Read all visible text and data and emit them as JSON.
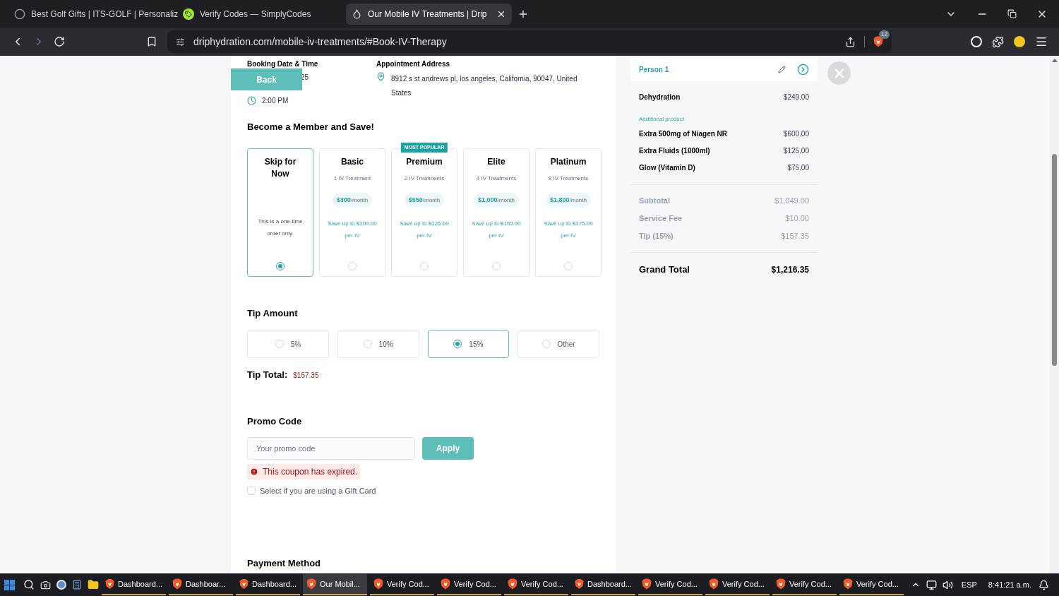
{
  "browser": {
    "tabs": [
      {
        "title": "Best Golf Gifts | ITS-GOLF | Personaliz",
        "selected": false
      },
      {
        "title": "Verify Codes — SimplyCodes",
        "selected": false
      },
      {
        "title": "Our Mobile IV Treatments | Drip",
        "selected": true
      }
    ],
    "url": "driphydration.com/mobile-iv-treatments/#Book-IV-Therapy",
    "shield_count": "12"
  },
  "booking": {
    "date_label": "Booking Date & Time",
    "date": "25",
    "time": "2:00 PM",
    "address_label": "Appointment Address",
    "address": "8912 s st andrews pl, los angeles, California, 90047, United States"
  },
  "back_button": "Back",
  "membership": {
    "title": "Become a Member and Save!",
    "plans": [
      {
        "name": "Skip for Now",
        "note": "This is a one-time order only.",
        "selected": true
      },
      {
        "name": "Basic",
        "treatments": "1 IV Treatment",
        "price": "$300",
        "period": "/month",
        "savings": "Save up to $100.00 per IV",
        "selected": false
      },
      {
        "name": "Premium",
        "badge": "MOST POPULAR",
        "treatments": "2 IV Treatments",
        "price": "$550",
        "period": "/month",
        "savings": "Save up to $125.00 per IV",
        "selected": false
      },
      {
        "name": "Elite",
        "treatments": "4 IV Treatments",
        "price": "$1,000",
        "period": "/month",
        "savings": "Save up to $150.00 per IV",
        "selected": false
      },
      {
        "name": "Platinum",
        "treatments": "8 IV Treatments",
        "price": "$1,800",
        "period": "/month",
        "savings": "Save up to $175.00 per IV",
        "selected": false
      }
    ]
  },
  "tip": {
    "title": "Tip Amount",
    "options": [
      {
        "label": "5%",
        "selected": false
      },
      {
        "label": "10%",
        "selected": false
      },
      {
        "label": "15%",
        "selected": true
      },
      {
        "label": "Other",
        "selected": false
      }
    ],
    "total_label": "Tip Total:",
    "total": "$157.35"
  },
  "promo": {
    "title": "Promo Code",
    "placeholder": "Your promo code",
    "apply": "Apply",
    "error": "This coupon has expired.",
    "gift_card": {
      "label": "Select if you are using a Gift Card",
      "checked": false
    }
  },
  "payment_title": "Payment Method",
  "summary": {
    "person": "Person 1",
    "service": {
      "name": "Dehydration",
      "price": "$249.00"
    },
    "additional_label": "Additional product",
    "products": [
      {
        "name": "Extra 500mg of Niagen NR",
        "price": "$600.00"
      },
      {
        "name": "Extra Fluids (1000ml)",
        "price": "$125.00"
      },
      {
        "name": "Glow (Vitamin D)",
        "price": "$75.00"
      }
    ],
    "fees": [
      {
        "name": "Subtotal",
        "price": "$1,049.00"
      },
      {
        "name": "Service Fee",
        "price": "$10.00"
      },
      {
        "name": "Tip (15%)",
        "price": "$157.35"
      }
    ],
    "grand_total_label": "Grand Total",
    "grand_total": "$1,216.35"
  },
  "taskbar": {
    "items": [
      {
        "label": "Dashboard...",
        "selected": false
      },
      {
        "label": "Dashboar...",
        "selected": false
      },
      {
        "label": "Dashboard...",
        "selected": false
      },
      {
        "label": "Our Mobil...",
        "selected": true
      },
      {
        "label": "Verify Cod...",
        "selected": false
      },
      {
        "label": "Verify Cod...",
        "selected": false
      },
      {
        "label": "Verify Cod...",
        "selected": false
      },
      {
        "label": "Dashboard...",
        "selected": false
      },
      {
        "label": "Verify Cod...",
        "selected": false
      },
      {
        "label": "Verify Cod...",
        "selected": false
      },
      {
        "label": "Verify Cod...",
        "selected": false
      },
      {
        "label": "Verify Cod...",
        "selected": false
      }
    ],
    "language": "ESP",
    "clock": "8:41:21 a.m."
  }
}
